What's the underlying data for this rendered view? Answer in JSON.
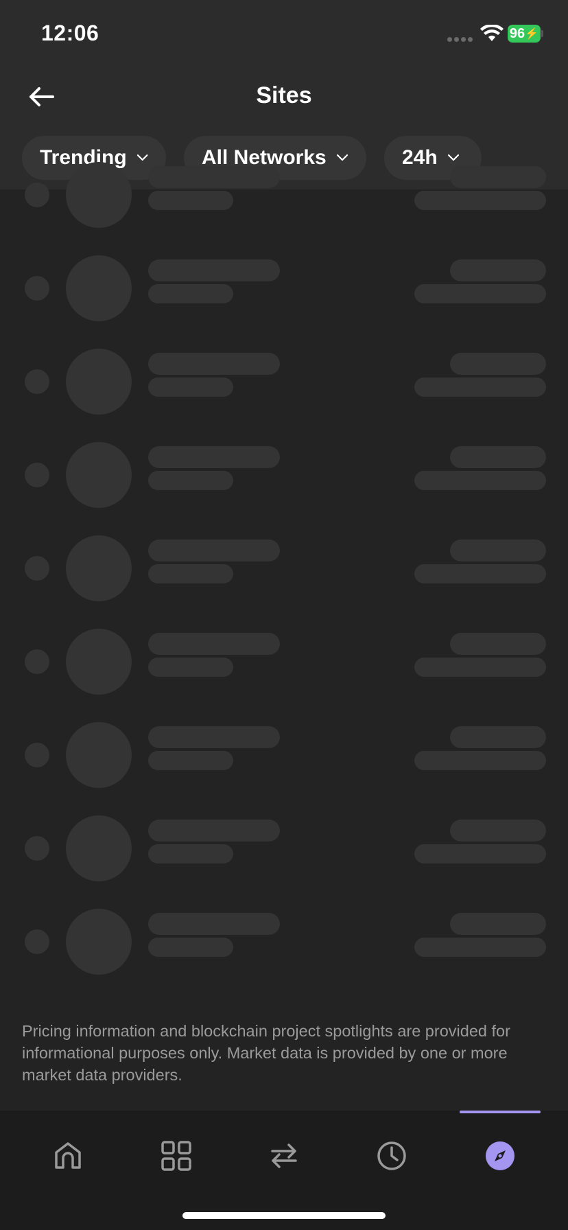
{
  "status_bar": {
    "time": "12:06",
    "battery": "96"
  },
  "header": {
    "title": "Sites",
    "back_icon": "arrow-left-icon"
  },
  "filters": [
    {
      "label": "Trending"
    },
    {
      "label": "All Networks"
    },
    {
      "label": "24h"
    }
  ],
  "list": {
    "state": "loading",
    "skeleton_rows": 9
  },
  "disclaimer": "Pricing information and blockchain project spotlights are provided for informational purposes only. Market data is provided by one or more market data providers.",
  "tabbar": {
    "items": [
      {
        "icon": "home-icon",
        "active": false
      },
      {
        "icon": "grid-icon",
        "active": false
      },
      {
        "icon": "swap-icon",
        "active": false
      },
      {
        "icon": "clock-icon",
        "active": false
      },
      {
        "icon": "compass-icon",
        "active": true
      }
    ],
    "active_color": "#a496f0"
  },
  "colors": {
    "background": "#232323",
    "header": "#2c2c2c",
    "skeleton": "#343434",
    "battery": "#34c759"
  }
}
